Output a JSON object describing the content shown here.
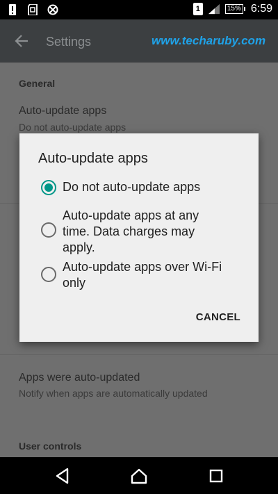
{
  "status_bar": {
    "battery_label": "15%",
    "sim_label": "1",
    "time": "6:59"
  },
  "toolbar": {
    "title": "Settings",
    "watermark": "www.techaruby.com"
  },
  "settings": {
    "general_header": "General",
    "auto_update_title": "Auto-update apps",
    "auto_update_summary": "Do not auto-update apps",
    "auto_updated_title": "Apps were auto-updated",
    "auto_updated_summary": "Notify when apps are automatically updated",
    "user_controls_header": "User controls"
  },
  "dialog": {
    "title": "Auto-update apps",
    "options": [
      {
        "label": "Do not auto-update apps",
        "checked": true
      },
      {
        "label": "Auto-update apps at any time. Data charges may apply.",
        "checked": false
      },
      {
        "label": "Auto-update apps over Wi-Fi only",
        "checked": false
      }
    ],
    "cancel_label": "CANCEL"
  },
  "colors": {
    "accent": "#009688",
    "annotation_arrow": "#1e88e5",
    "watermark": "#1fa2e8"
  }
}
